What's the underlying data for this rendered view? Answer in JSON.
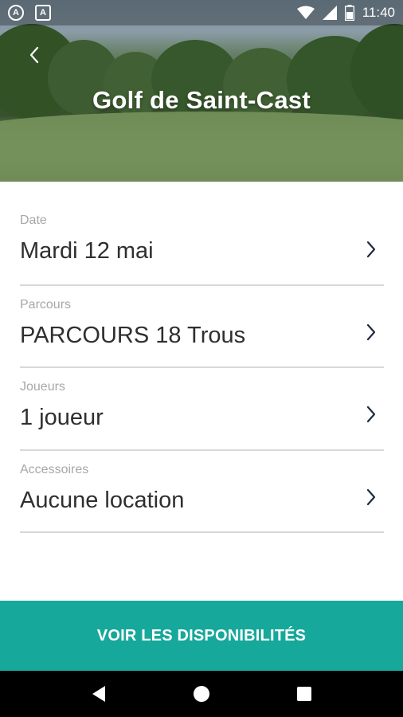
{
  "status_bar": {
    "time": "11:40",
    "left_icons": [
      "app-a-icon",
      "app-a-outline-icon"
    ],
    "right_icons": [
      "wifi-icon",
      "signal-icon",
      "battery-icon"
    ]
  },
  "header": {
    "title": "Golf de Saint-Cast",
    "back_icon": "chevron-left-icon"
  },
  "form": {
    "rows": [
      {
        "label": "Date",
        "value": "Mardi 12 mai"
      },
      {
        "label": "Parcours",
        "value": "PARCOURS 18 Trous"
      },
      {
        "label": "Joueurs",
        "value": "1 joueur"
      },
      {
        "label": "Accessoires",
        "value": "Aucune location"
      }
    ]
  },
  "cta": {
    "label": "VOIR LES DISPONIBILITÉS",
    "color": "#16a89a"
  },
  "navbar": {
    "icons": [
      "back-triangle-icon",
      "home-circle-icon",
      "recents-square-icon"
    ]
  }
}
